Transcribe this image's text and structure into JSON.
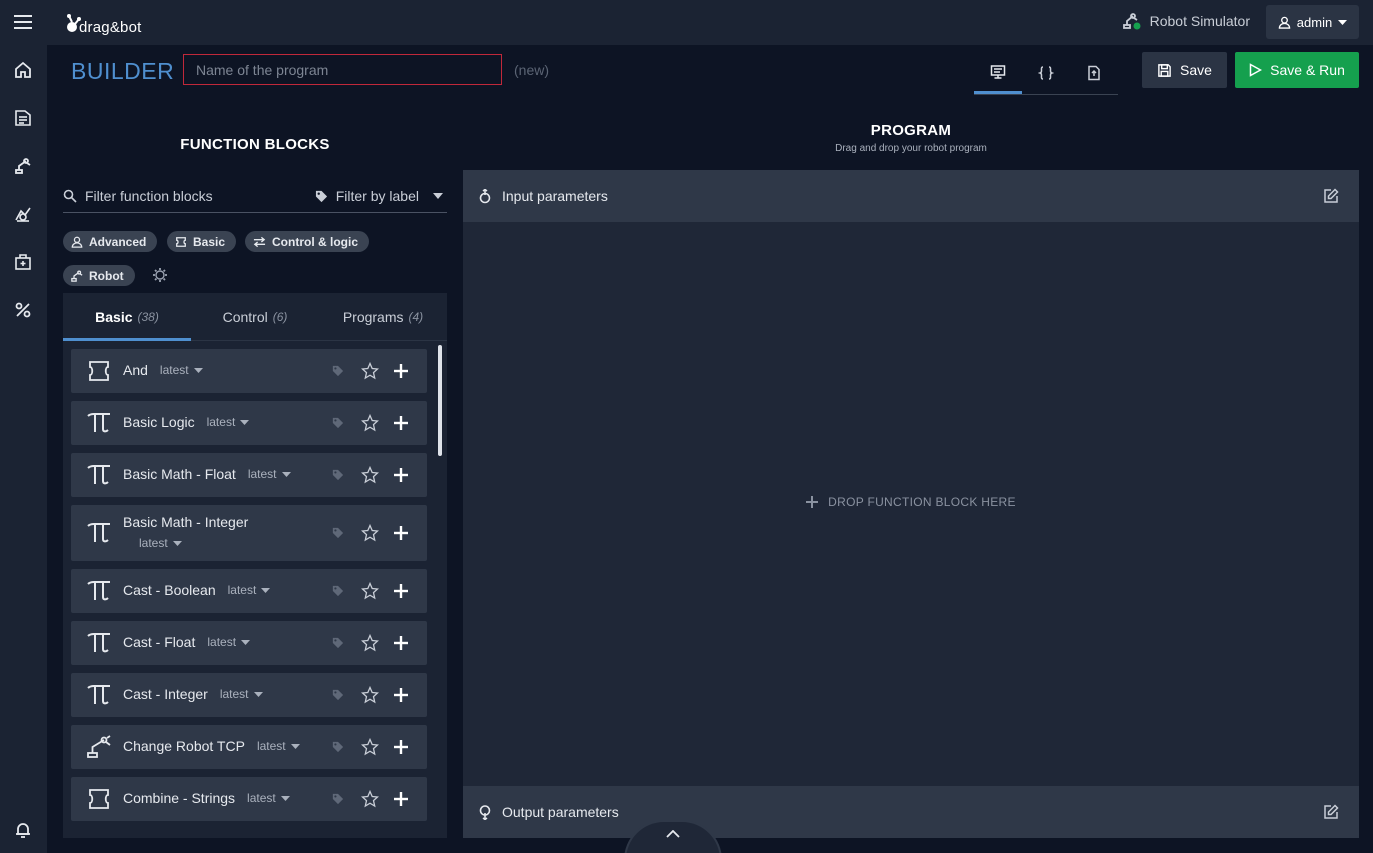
{
  "app": {
    "logo_text": "drag&bot"
  },
  "topbar": {
    "simulator_label": "Robot Simulator",
    "user_label": "admin"
  },
  "builder": {
    "title": "BUILDER",
    "name_placeholder": "Name of the program",
    "new_label": "(new)",
    "save_label": "Save",
    "save_run_label": "Save & Run"
  },
  "function_blocks": {
    "title": "FUNCTION BLOCKS",
    "filter_placeholder": "Filter function blocks",
    "filter_label": "Filter by label",
    "chips": [
      "Advanced",
      "Basic",
      "Control & logic",
      "Robot"
    ],
    "tabs": [
      {
        "label": "Basic",
        "count": "(38)"
      },
      {
        "label": "Control",
        "count": "(6)"
      },
      {
        "label": "Programs",
        "count": "(4)"
      }
    ],
    "items": [
      {
        "name": "And",
        "version": "latest",
        "icon": "puzzle-icon"
      },
      {
        "name": "Basic Logic",
        "version": "latest",
        "icon": "pi-icon"
      },
      {
        "name": "Basic Math - Float",
        "version": "latest",
        "icon": "pi-icon"
      },
      {
        "name": "Basic Math - Integer",
        "version": "latest",
        "icon": "pi-icon"
      },
      {
        "name": "Cast - Boolean",
        "version": "latest",
        "icon": "pi-icon"
      },
      {
        "name": "Cast - Float",
        "version": "latest",
        "icon": "pi-icon"
      },
      {
        "name": "Cast - Integer",
        "version": "latest",
        "icon": "pi-icon"
      },
      {
        "name": "Change Robot TCP",
        "version": "latest",
        "icon": "robot-arm-icon"
      },
      {
        "name": "Combine - Strings",
        "version": "latest",
        "icon": "puzzle-icon"
      }
    ]
  },
  "program": {
    "title": "PROGRAM",
    "subtitle": "Drag and drop your robot program",
    "input_params_label": "Input parameters",
    "output_params_label": "Output parameters",
    "drop_label": "DROP FUNCTION BLOCK HERE"
  },
  "colors": {
    "accent": "#4f8fcf",
    "run_green": "#15a04e",
    "error_border": "#c0283a"
  }
}
